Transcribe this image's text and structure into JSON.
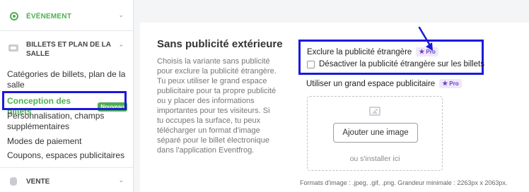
{
  "sidebar": {
    "sections": [
      {
        "label": "ÉVÉNEMENT",
        "icon": "location-pin-icon"
      },
      {
        "label": "BILLETS ET PLAN DE LA SALLE",
        "icon": "ticket-icon"
      },
      {
        "label": "VENTE",
        "icon": "coins-icon"
      }
    ],
    "items": [
      {
        "label": "Catégories de billets, plan de la salle"
      },
      {
        "label": "Conception des billets",
        "badge": "Nouveau",
        "active": true
      },
      {
        "label": "Personnalisation, champs supplémentaires"
      },
      {
        "label": "Modes de paiement"
      },
      {
        "label": "Coupons, espaces publicitaires"
      }
    ]
  },
  "main": {
    "title": "Sans publicité extérieure",
    "description": "Choisis la variante sans publicité pour exclure la publicité étrangère. Tu peux utiliser le grand espace publicitaire pour ta propre publicité ou y placer des informations importantes pour tes visiteurs. Si tu occupes la surface, tu peux télécharger un format d'image séparé pour le billet électronique dans l'application Eventfrog.",
    "option_exclude": {
      "title": "Exclure la publicité étrangère",
      "badge": "Pro",
      "checkbox_label": "Désactiver la publicité étrangère sur les billets",
      "checked": false
    },
    "option_large_space": {
      "title": "Utiliser un grand espace publicitaire",
      "badge": "Pro"
    },
    "upload": {
      "button_label": "Ajouter une image",
      "or_text": "ou s'installer ici"
    },
    "formats_note": "Formats d'image : .jpeg, .gif, .png. Grandeur minimale : 2263px x 2063px."
  },
  "colors": {
    "accent_green": "#4caf50",
    "annotation_blue": "#1a1adb",
    "pro_purple": "#6b3fc8"
  }
}
